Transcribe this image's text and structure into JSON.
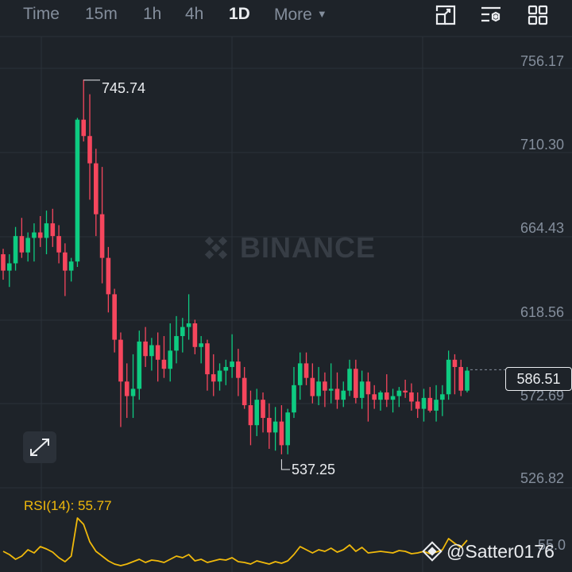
{
  "toolbar": {
    "tabs": [
      {
        "label": "Time",
        "active": false
      },
      {
        "label": "15m",
        "active": false
      },
      {
        "label": "1h",
        "active": false
      },
      {
        "label": "4h",
        "active": false
      },
      {
        "label": "1D",
        "active": true
      },
      {
        "label": "More",
        "active": false
      }
    ],
    "icons": [
      "chart-type-icon",
      "indicator-settings-icon",
      "layout-grid-icon"
    ]
  },
  "colors": {
    "background": "#1e2329",
    "up": "#0ecb81",
    "down": "#f6465d",
    "grid": "#2b3139",
    "axis_text": "#848e9c",
    "rsi_line": "#f0b90b"
  },
  "watermark": "BINANCE",
  "credit": "@Satter0176",
  "expand_icon": "expand-arrows-icon",
  "chart_data": [
    {
      "type": "candlestick",
      "interval": "1D",
      "price_axis_labels": [
        "756.17",
        "710.30",
        "664.43",
        "618.56",
        "572.69",
        "526.82"
      ],
      "ylim": [
        520,
        764
      ],
      "high_marker": "745.74",
      "low_marker": "537.25",
      "current_price": "586.51",
      "candles": [
        [
          650,
          653,
          636,
          641
        ],
        [
          641,
          650,
          632,
          645
        ],
        [
          645,
          665,
          641,
          660
        ],
        [
          660,
          670,
          648,
          651
        ],
        [
          651,
          662,
          646,
          659
        ],
        [
          659,
          667,
          646,
          662
        ],
        [
          662,
          671,
          654,
          659
        ],
        [
          659,
          674,
          650,
          667
        ],
        [
          667,
          675,
          654,
          660
        ],
        [
          660,
          666,
          645,
          651
        ],
        [
          651,
          656,
          627,
          641
        ],
        [
          641,
          648,
          635,
          646
        ],
        [
          646,
          725,
          643,
          724
        ],
        [
          724,
          746,
          712,
          715
        ],
        [
          715,
          738,
          680,
          700
        ],
        [
          700,
          708,
          660,
          672
        ],
        [
          672,
          698,
          634,
          648
        ],
        [
          648,
          654,
          618,
          628
        ],
        [
          628,
          631,
          596,
          603
        ],
        [
          603,
          607,
          555,
          580
        ],
        [
          580,
          590,
          560,
          572
        ],
        [
          572,
          595,
          560,
          576
        ],
        [
          576,
          608,
          570,
          602
        ],
        [
          602,
          610,
          588,
          594
        ],
        [
          594,
          604,
          586,
          600
        ],
        [
          600,
          607,
          580,
          592
        ],
        [
          592,
          605,
          582,
          587
        ],
        [
          587,
          612,
          580,
          597
        ],
        [
          597,
          616,
          590,
          605
        ],
        [
          605,
          615,
          596,
          610
        ],
        [
          610,
          628,
          603,
          612
        ],
        [
          612,
          614,
          595,
          599
        ],
        [
          599,
          605,
          590,
          601
        ],
        [
          601,
          603,
          575,
          584
        ],
        [
          584,
          595,
          572,
          580
        ],
        [
          580,
          590,
          575,
          586
        ],
        [
          586,
          592,
          578,
          588
        ],
        [
          588,
          606,
          582,
          591
        ],
        [
          591,
          598,
          572,
          582
        ],
        [
          582,
          588,
          565,
          567
        ],
        [
          567,
          575,
          545,
          556
        ],
        [
          556,
          576,
          550,
          570
        ],
        [
          570,
          574,
          552,
          560
        ],
        [
          560,
          568,
          543,
          552
        ],
        [
          552,
          566,
          542,
          558
        ],
        [
          558,
          567,
          540,
          545
        ],
        [
          545,
          565,
          540,
          563
        ],
        [
          563,
          588,
          560,
          578
        ],
        [
          578,
          596,
          570,
          590
        ],
        [
          590,
          596,
          578,
          582
        ],
        [
          582,
          590,
          568,
          572
        ],
        [
          572,
          588,
          567,
          580
        ],
        [
          580,
          585,
          566,
          575
        ],
        [
          575,
          590,
          568,
          576
        ],
        [
          576,
          585,
          565,
          570
        ],
        [
          570,
          580,
          566,
          575
        ],
        [
          575,
          592,
          572,
          587
        ],
        [
          587,
          592,
          568,
          571
        ],
        [
          571,
          586,
          565,
          580
        ],
        [
          580,
          585,
          558,
          573
        ],
        [
          573,
          578,
          565,
          570
        ],
        [
          570,
          575,
          564,
          574
        ],
        [
          574,
          584,
          566,
          570
        ],
        [
          570,
          576,
          563,
          572
        ],
        [
          572,
          577,
          566,
          575
        ],
        [
          575,
          581,
          571,
          574
        ],
        [
          574,
          579,
          564,
          569
        ],
        [
          569,
          574,
          560,
          565
        ],
        [
          565,
          576,
          558,
          571
        ],
        [
          571,
          577,
          563,
          564
        ],
        [
          564,
          578,
          558,
          570
        ],
        [
          570,
          578,
          561,
          573
        ],
        [
          573,
          597,
          570,
          592
        ],
        [
          592,
          595,
          573,
          588
        ],
        [
          588,
          592,
          572,
          575
        ],
        [
          575,
          588,
          574,
          586
        ]
      ]
    },
    {
      "type": "line",
      "title": "RSI(14): 55.77",
      "indicator": "RSI",
      "period": 14,
      "last_value": "55.77",
      "axis_label_partial": "55.0",
      "values": [
        28,
        24,
        18,
        22,
        30,
        26,
        34,
        31,
        27,
        20,
        15,
        22,
        70,
        62,
        40,
        28,
        22,
        16,
        12,
        10,
        12,
        15,
        18,
        14,
        17,
        16,
        14,
        18,
        22,
        20,
        24,
        16,
        18,
        14,
        16,
        18,
        17,
        20,
        15,
        14,
        12,
        16,
        14,
        12,
        15,
        13,
        16,
        24,
        34,
        30,
        26,
        30,
        28,
        32,
        27,
        30,
        36,
        28,
        33,
        26,
        27,
        28,
        27,
        26,
        29,
        28,
        25,
        26,
        28,
        25,
        27,
        30,
        44,
        38,
        33,
        42
      ],
      "ylim": [
        0,
        100
      ]
    }
  ]
}
